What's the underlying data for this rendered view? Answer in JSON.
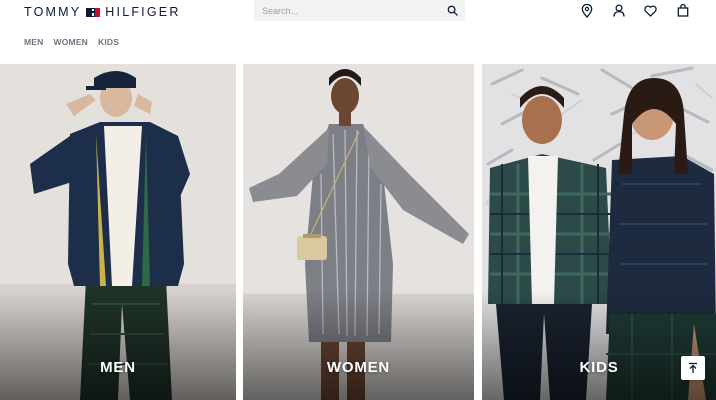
{
  "brand": {
    "left": "TOMMY",
    "right": "HILFIGER"
  },
  "search": {
    "placeholder": "Search..."
  },
  "header_icons": [
    "location-pin-icon",
    "account-icon",
    "heart-icon",
    "bag-icon"
  ],
  "nav": {
    "items": [
      {
        "label": "MEN"
      },
      {
        "label": "WOMEN"
      },
      {
        "label": "KIDS"
      }
    ]
  },
  "tiles": [
    {
      "label": "MEN"
    },
    {
      "label": "WOMEN"
    },
    {
      "label": "KIDS"
    }
  ],
  "colors": {
    "navy": "#0b1a36",
    "red": "#c8102e",
    "search_bg": "#f2f2f2",
    "nav_text": "#6e7480"
  }
}
